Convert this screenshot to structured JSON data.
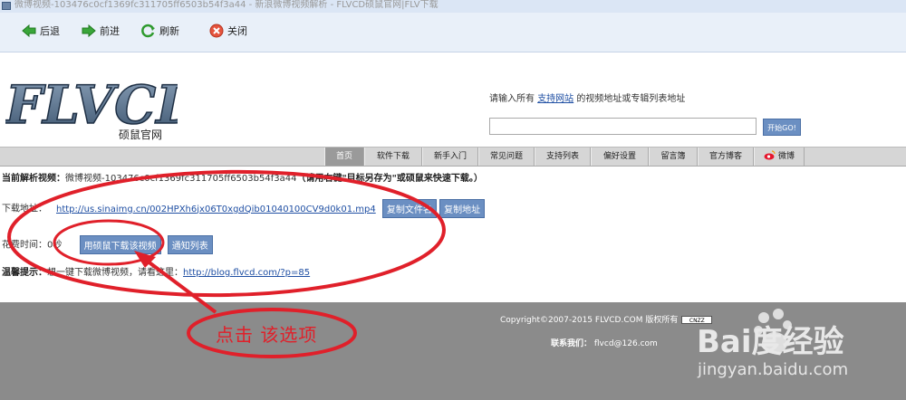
{
  "window": {
    "title": "微博视频-103476c0cf1369fc311705ff6503b54f3a44 - 新浪微博视频解析 - FLVCD硕鼠官网|FLV下载"
  },
  "toolbar": {
    "back_label": "后退",
    "forward_label": "前进",
    "refresh_label": "刷新",
    "close_label": "关闭"
  },
  "header": {
    "logo_text": "FLVCD",
    "logo_subtitle": "硕鼠官网",
    "prompt_before": "请输入所有",
    "prompt_link": "支持网站",
    "prompt_after": "的视频地址或专辑列表地址",
    "url_value": "",
    "start_button": "开始GO!"
  },
  "nav": {
    "items": [
      {
        "label": "首页",
        "active": true
      },
      {
        "label": "软件下载",
        "active": false
      },
      {
        "label": "新手入门",
        "active": false
      },
      {
        "label": "常见问题",
        "active": false
      },
      {
        "label": "支持列表",
        "active": false
      },
      {
        "label": "偏好设置",
        "active": false
      },
      {
        "label": "留言簿",
        "active": false
      },
      {
        "label": "官方博客",
        "active": false
      },
      {
        "label": "微博",
        "active": false
      }
    ]
  },
  "content": {
    "current_label": "当前解析视频：",
    "current_value": "微博视频-103476c0cf1369fc311705ff6503b54f3a44",
    "current_note": "（请用右键\"目标另存为\"或硕鼠来快速下载。）",
    "download_label": "下载地址：",
    "download_url": "http://us.sinaimg.cn/002HPXh6jx06T0xgdQib01040100CV9d0k01.mp4",
    "copy_filename_button": "复制文件名",
    "copy_url_button": "复制地址",
    "time_label": "花费时间：",
    "time_value": "0秒",
    "use_flvcd_button": "用硕鼠下载该视频",
    "notify_list_button": "通知列表",
    "tip_label": "温馨提示：",
    "tip_text": "想一键下载微博视频，请看这里：",
    "tip_link": "http://blog.flvcd.com/?p=85"
  },
  "footer": {
    "copyright": "Copyright©2007-2015 FLVCD.COM 版权所有",
    "cnzz_badge": "CNZZ",
    "contact_label": "联系我们：",
    "contact_email": "flvcd@126.com"
  },
  "annotation": {
    "callout": "点击 该选项",
    "color": "#e0202a"
  },
  "watermark": {
    "brand": "Bai度经验",
    "url": "jingyan.baidu.com"
  },
  "colors": {
    "accent_blue": "#6b8fc2",
    "footer_gray": "#8b8b8b",
    "nav_gray": "#d6d6d6",
    "annotation_red": "#e0202a"
  }
}
